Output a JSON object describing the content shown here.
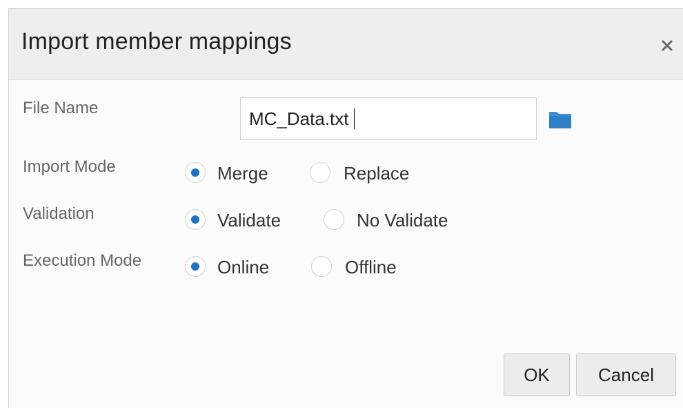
{
  "dialog": {
    "title": "Import member mappings",
    "close_icon": "close-icon"
  },
  "form": {
    "file_name": {
      "label": "File Name",
      "value": "MC_Data.txt",
      "browse_icon": "folder-icon",
      "browse_icon_color": "#3a8fd6"
    },
    "import_mode": {
      "label": "Import Mode",
      "options": [
        "Merge",
        "Replace"
      ],
      "selected": "Merge"
    },
    "validation": {
      "label": "Validation",
      "options": [
        "Validate",
        "No Validate"
      ],
      "selected": "Validate"
    },
    "execution_mode": {
      "label": "Execution Mode",
      "options": [
        "Online",
        "Offline"
      ],
      "selected": "Online"
    }
  },
  "buttons": {
    "ok": "OK",
    "cancel": "Cancel"
  },
  "colors": {
    "accent": "#1d72c9",
    "header_bg": "#eeeeee"
  }
}
